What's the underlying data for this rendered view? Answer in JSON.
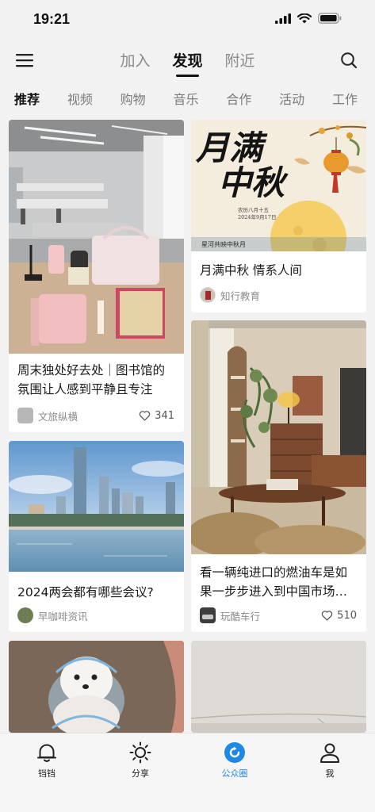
{
  "status": {
    "time": "19:21"
  },
  "topnav": {
    "tabs": [
      "加入",
      "发现",
      "附近"
    ],
    "active": 1
  },
  "categories": [
    "推荐",
    "视频",
    "购物",
    "音乐",
    "合作",
    "活动",
    "工作"
  ],
  "feed": {
    "left": [
      {
        "title": "周末独处好去处｜图书馆的氛围让人感到平静且专注",
        "author": "文旅纵横",
        "likes": "341"
      },
      {
        "title": "2024两会都有哪些会议?",
        "author": "早咖啡资讯"
      }
    ],
    "right": [
      {
        "title": "月满中秋 情系人间",
        "author": "知行教育",
        "poster": {
          "main_line1": "月满",
          "main_line2": "中秋",
          "sub": "农历八月十五",
          "date": "2024年9月17日",
          "footer": "星河共映中秋月"
        }
      },
      {
        "title": "看一辆纯进口的燃油车是如果一步步进入到中国市场…",
        "author": "玩酷车行",
        "likes": "510"
      }
    ]
  },
  "bottom_nav": [
    {
      "label": "铛铛",
      "icon": "bell-icon"
    },
    {
      "label": "分享",
      "icon": "sun-icon"
    },
    {
      "label": "公众圈",
      "icon": "circle-refresh-icon",
      "active": true
    },
    {
      "label": "我",
      "icon": "person-icon"
    }
  ],
  "colors": {
    "accent": "#1e88e5",
    "text": "#1a1a1a",
    "muted": "#8a8a8a"
  }
}
